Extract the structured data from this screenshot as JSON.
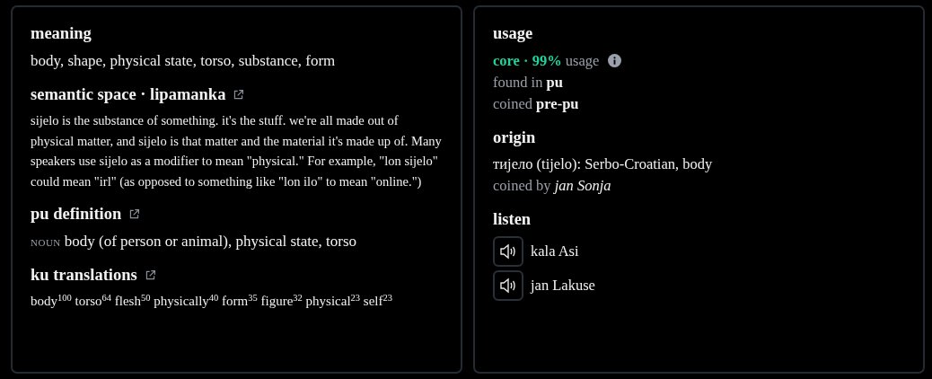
{
  "left": {
    "sections": [
      {
        "kind": "plain",
        "title": "meaning",
        "text": "body, shape, physical state, torso, substance, form"
      },
      {
        "kind": "semantic",
        "title": "semantic space · lipamanka",
        "link": true,
        "text": "sijelo is the substance of something. it's the stuff. we're all made out of physical matter, and sijelo is that matter and the material it's made up of. Many speakers use sijelo as a modifier to mean \"physical.\" For example, \"lon sijelo\" could mean \"irl\" (as opposed to something like \"lon ilo\" to mean \"online.\")"
      },
      {
        "kind": "definition",
        "title": "pu definition",
        "link": true,
        "pos": "NOUN",
        "text": "body (of person or animal), physical state, torso"
      },
      {
        "kind": "translations",
        "title": "ku translations",
        "link": true,
        "items": [
          {
            "word": "body",
            "score": "100"
          },
          {
            "word": "torso",
            "score": "64"
          },
          {
            "word": "flesh",
            "score": "50"
          },
          {
            "word": "physically",
            "score": "40"
          },
          {
            "word": "form",
            "score": "35"
          },
          {
            "word": "figure",
            "score": "32"
          },
          {
            "word": "physical",
            "score": "23"
          },
          {
            "word": "self",
            "score": "23"
          }
        ]
      }
    ]
  },
  "right": {
    "usage": {
      "title": "usage",
      "tier": "core · 99%",
      "label": "usage",
      "info": true,
      "lines": [
        {
          "label": "found in",
          "value": "pu"
        },
        {
          "label": "coined",
          "value": "pre-pu"
        }
      ]
    },
    "origin": {
      "title": "origin",
      "text": "тијело (tijelo): Serbo-Croatian, body",
      "coined_label": "coined by",
      "coined_by": "jan Sonja"
    },
    "listen": {
      "title": "listen",
      "speakers": [
        "kala Asi",
        "jan Lakuse"
      ]
    }
  }
}
